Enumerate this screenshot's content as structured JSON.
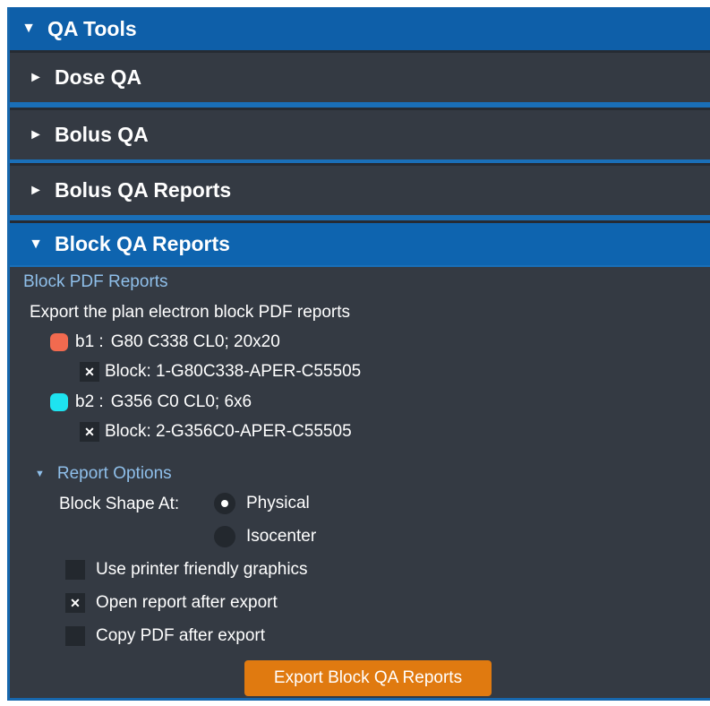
{
  "panel": {
    "title": "QA Tools",
    "expanded_arrow": "▼",
    "collapsed_arrow": "►",
    "sections": [
      {
        "label": "Dose QA"
      },
      {
        "label": "Bolus QA"
      },
      {
        "label": "Bolus QA Reports"
      },
      {
        "label": "Block QA Reports"
      }
    ]
  },
  "block_qa": {
    "section_title": "Block PDF Reports",
    "description": "Export the plan electron block PDF reports",
    "beams": [
      {
        "id": "b1 :",
        "detail": "G80 C338 CL0; 20x20",
        "color": "#f26a4f",
        "block": {
          "label": "Block: 1-G80C338-APER-C55505",
          "checked": true
        }
      },
      {
        "id": "b2 :",
        "detail": "G356 C0 CL0; 6x6",
        "color": "#1ee3f0",
        "block": {
          "label": "Block: 2-G356C0-APER-C55505",
          "checked": true
        }
      }
    ],
    "report_options": {
      "title": "Report Options",
      "block_shape_label": "Block Shape At:",
      "shape_options": [
        {
          "label": "Physical",
          "selected": true
        },
        {
          "label": "Isocenter",
          "selected": false
        }
      ],
      "checkboxes": [
        {
          "label": "Use printer friendly graphics",
          "checked": false
        },
        {
          "label": "Open report after export",
          "checked": true
        },
        {
          "label": "Copy PDF after export",
          "checked": false
        }
      ]
    },
    "export_button": "Export Block QA Reports"
  },
  "colors": {
    "accent_blue": "#0e64af",
    "panel_dark": "#343a43",
    "link_blue": "#8fbfea",
    "button_orange": "#e07a10"
  }
}
